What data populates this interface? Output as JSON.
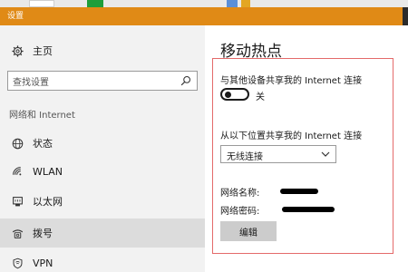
{
  "window": {
    "title": "设置",
    "accent_color": "#e08a16"
  },
  "sidebar": {
    "home_label": "主页",
    "search": {
      "placeholder": "查找设置",
      "icon": "search-icon"
    },
    "section_heading": "网络和 Internet",
    "items": [
      {
        "label": "状态",
        "icon": "globe-icon",
        "active": false
      },
      {
        "label": "WLAN",
        "icon": "wifi-icon",
        "active": false
      },
      {
        "label": "以太网",
        "icon": "ethernet-icon",
        "active": false
      },
      {
        "label": "拨号",
        "icon": "dialup-icon",
        "active": true
      },
      {
        "label": "VPN",
        "icon": "vpn-icon",
        "active": false
      }
    ]
  },
  "main": {
    "title": "移动热点",
    "share_label": "与其他设备共享我的 Internet 连接",
    "toggle_state": "关",
    "share_from_label": "从以下位置共享我的 Internet 连接",
    "share_from_value": "无线连接",
    "network_name_label": "网络名称:",
    "network_password_label": "网络密码:",
    "edit_button": "编辑",
    "highlight_color": "#e46a6a"
  }
}
